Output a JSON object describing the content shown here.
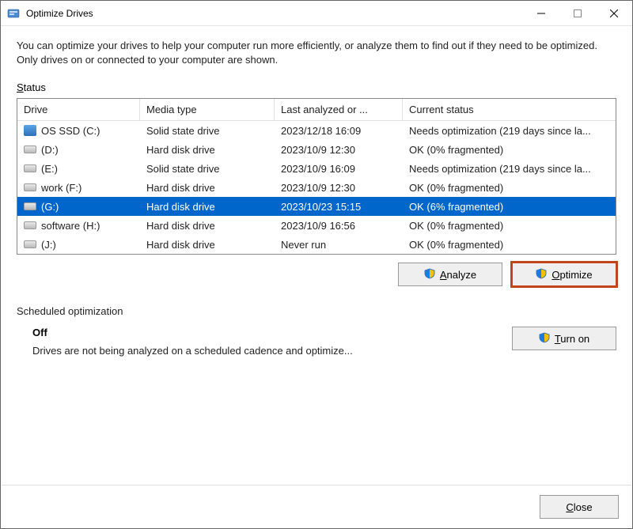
{
  "window": {
    "title": "Optimize Drives"
  },
  "intro": "You can optimize your drives to help your computer run more efficiently, or analyze them to find out if they need to be optimized. Only drives on or connected to your computer are shown.",
  "status_label_pre": "S",
  "status_label_rest": "tatus",
  "columns": {
    "drive": "Drive",
    "media": "Media type",
    "last": "Last analyzed or ...",
    "status": "Current status"
  },
  "drives": [
    {
      "icon": "ssd",
      "name": "OS SSD (C:)",
      "media": "Solid state drive",
      "last": "2023/12/18 16:09",
      "status": "Needs optimization (219 days since la...",
      "selected": false
    },
    {
      "icon": "hdd",
      "name": "(D:)",
      "media": "Hard disk drive",
      "last": "2023/10/9 12:30",
      "status": "OK (0% fragmented)",
      "selected": false
    },
    {
      "icon": "hdd",
      "name": "(E:)",
      "media": "Solid state drive",
      "last": "2023/10/9 16:09",
      "status": "Needs optimization (219 days since la...",
      "selected": false
    },
    {
      "icon": "hdd",
      "name": "work (F:)",
      "media": "Hard disk drive",
      "last": "2023/10/9 12:30",
      "status": "OK (0% fragmented)",
      "selected": false
    },
    {
      "icon": "hdd",
      "name": "(G:)",
      "media": "Hard disk drive",
      "last": "2023/10/23 15:15",
      "status": "OK (6% fragmented)",
      "selected": true
    },
    {
      "icon": "hdd",
      "name": "software (H:)",
      "media": "Hard disk drive",
      "last": "2023/10/9 16:56",
      "status": "OK (0% fragmented)",
      "selected": false
    },
    {
      "icon": "hdd",
      "name": "(J:)",
      "media": "Hard disk drive",
      "last": "Never run",
      "status": "OK (0% fragmented)",
      "selected": false
    }
  ],
  "buttons": {
    "analyze_pre": "A",
    "analyze_rest": "nalyze",
    "optimize_pre": "O",
    "optimize_rest": "ptimize",
    "turn_on_pre": "T",
    "turn_on_rest": "urn on",
    "close_pre": "C",
    "close_rest": "lose"
  },
  "scheduled": {
    "label": "Scheduled optimization",
    "state": "Off",
    "desc": "Drives are not being analyzed on a scheduled cadence and optimize..."
  }
}
